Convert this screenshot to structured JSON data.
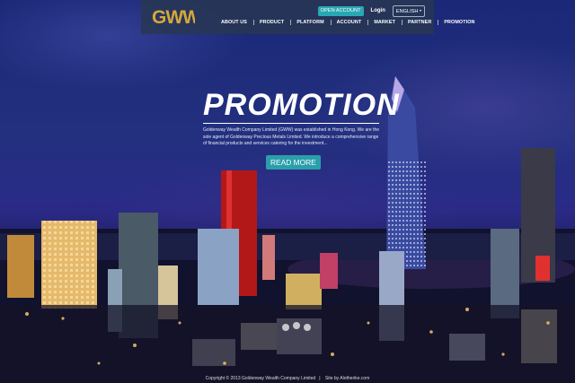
{
  "header": {
    "logo_text": "GWW",
    "actions": {
      "open_account": "OPEN ACCOUNT",
      "login": "Login",
      "language": "ENGLISH"
    },
    "nav": [
      "ABOUT US",
      "PRODUCT",
      "PLATFORM",
      "ACCOUNT",
      "MARKET",
      "PARTNER",
      "PROMOTION"
    ]
  },
  "hero": {
    "title": "PROMOTION",
    "description": "Goldenway Wealth Company Limited (GWW) was established in Hong Kong. We are the sole agent of Goldenway Precious Metals Limited. We introduce a comprehensive range of financial products and services catering for the investment...",
    "cta": "READ MORE"
  },
  "footer": {
    "copyright": "Copyright © 2013 Goldenway Wealth Company Limited",
    "credit": "Site by Alotherike.com"
  },
  "colors": {
    "header_bg": "#283750",
    "accent": "#2aa7b4",
    "logo": "#d4a93a"
  },
  "icons": {
    "language_dropdown": "chevron-down-icon"
  }
}
